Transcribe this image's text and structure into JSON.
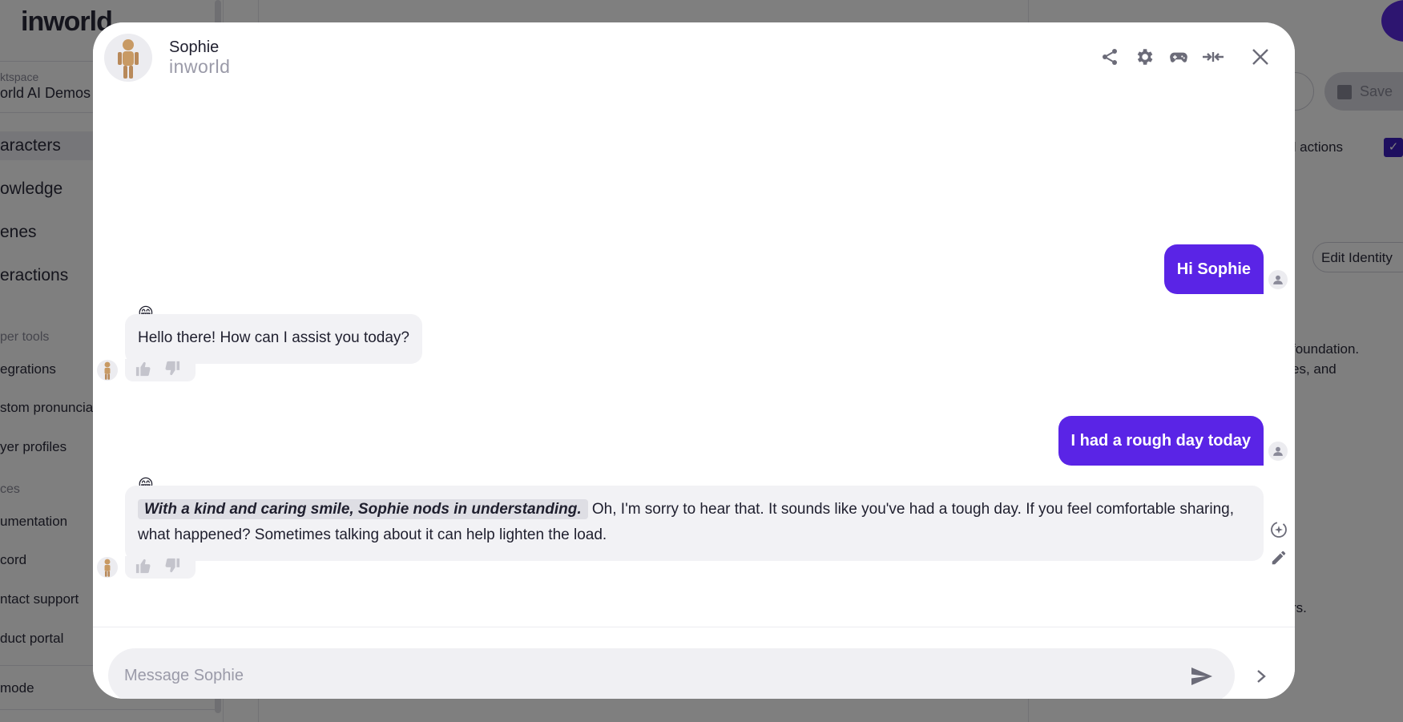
{
  "background": {
    "logo": "inworld",
    "workspace_label": "ktspace",
    "workspace_name": "orld AI Demos",
    "nav": [
      "aracters",
      "owledge",
      "enes",
      "eractions"
    ],
    "section_developer": "per tools",
    "dev_links": [
      "egrations",
      "stom pronuncia",
      "yer profiles"
    ],
    "section_resources": "ces",
    "resource_links": [
      "umentation",
      "cord",
      "ntact support",
      "duct portal"
    ],
    "mode_label": "mode",
    "save_label": "Save",
    "partial_button": "t",
    "actions_label": "d actions",
    "edit_identity": "Edit Identity",
    "desc_line1": "foundation.",
    "desc_line2": "es, and",
    "desc_line3": "rs."
  },
  "modal": {
    "character_name": "Sophie",
    "brand": "inworld",
    "header_icons": [
      "share-icon",
      "gear-icon",
      "gamepad-icon",
      "collapse-arrows-icon",
      "close-icon"
    ]
  },
  "messages": [
    {
      "role": "user",
      "text": "Hi Sophie"
    },
    {
      "role": "bot",
      "emoji": "😁",
      "text": "Hello there! How can I assist you today?"
    },
    {
      "role": "user",
      "text": "I had a rough day today"
    },
    {
      "role": "bot",
      "emoji": "😁",
      "narration": "With a kind and caring smile, Sophie nods in understanding.",
      "text": "Oh, I'm sorry to hear that. It sounds like you've had a tough day. If you feel comfortable sharing, what happened? Sometimes talking about it can help lighten the load."
    }
  ],
  "composer": {
    "placeholder": "Message Sophie"
  },
  "colors": {
    "accent": "#5a24e6",
    "bot_bubble": "#f2f2f5",
    "overlay": "rgba(0,0,0,0.5)"
  }
}
